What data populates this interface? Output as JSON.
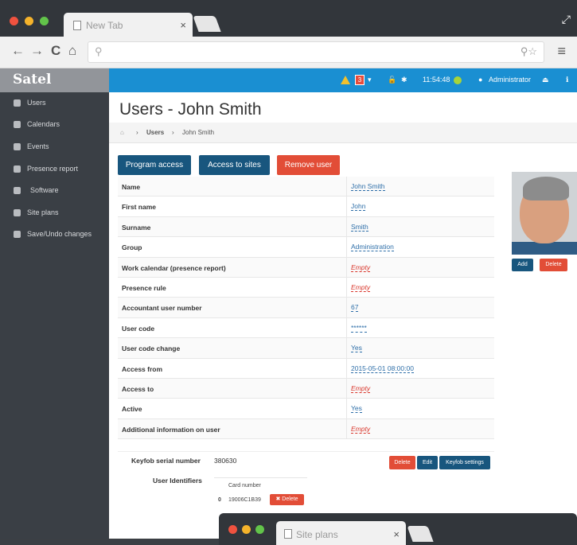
{
  "browser": {
    "tab_title": "New Tab",
    "tab_close": "×",
    "expand_icon": "⤢",
    "back_icon": "←",
    "forward_icon": "→",
    "reload_icon": "C",
    "home_icon": "⌂",
    "search_icon": "⚲",
    "url_right_icons": "⚲☆",
    "menu_icon": "≡"
  },
  "app": {
    "logo": "Satel",
    "sidebar": [
      {
        "label": "Users",
        "icon": "user-icon"
      },
      {
        "label": "Calendars",
        "icon": "calendar-icon"
      },
      {
        "label": "Events",
        "icon": "events-icon"
      },
      {
        "label": "Presence report",
        "icon": "report-icon"
      },
      {
        "label": "Software",
        "icon": "software-icon"
      },
      {
        "label": "Site plans",
        "icon": "image-icon"
      },
      {
        "label": "Save/Undo changes",
        "icon": "save-icon"
      }
    ],
    "topbar": {
      "alert_count": "3",
      "alert_caret": "▾",
      "time": "11:54:48",
      "user_label": "Administrator",
      "logout_icon": "⏏",
      "info_icon": "ℹ",
      "lock_icon": "🔓",
      "gear_icon": "✱"
    },
    "page_title": "Users - John Smith",
    "breadcrumb": {
      "home": "⌂",
      "sep1": "›",
      "users": "Users",
      "sep2": "›",
      "current": "John Smith"
    },
    "actions": {
      "program_access": "Program access",
      "access_to_sites": "Access to sites",
      "remove_user": "Remove user"
    },
    "fields": [
      {
        "key": "Name",
        "value": "John Smith",
        "empty": false
      },
      {
        "key": "First name",
        "value": "John",
        "empty": false
      },
      {
        "key": "Surname",
        "value": "Smith",
        "empty": false
      },
      {
        "key": "Group",
        "value": "Administration",
        "empty": false
      },
      {
        "key": "Work calendar (presence report)",
        "value": "Empty",
        "empty": true
      },
      {
        "key": "Presence rule",
        "value": "Empty",
        "empty": true
      },
      {
        "key": "Accountant user number",
        "value": "67",
        "empty": false
      },
      {
        "key": "User code",
        "value": "******",
        "empty": false
      },
      {
        "key": "User code change",
        "value": "Yes",
        "empty": false
      },
      {
        "key": "Access from",
        "value": "2015-05-01 08:00:00",
        "empty": false
      },
      {
        "key": "Access to",
        "value": "Empty",
        "empty": true
      },
      {
        "key": "Active",
        "value": "Yes",
        "empty": false
      },
      {
        "key": "Additional information on user",
        "value": "Empty",
        "empty": true
      }
    ],
    "photo": {
      "add": "Add",
      "delete": "Delete"
    },
    "keyfob": {
      "serial_label": "Keyfob serial number",
      "serial_value": "380630",
      "delete": "Delete",
      "edit": "Edit",
      "settings": "Keyfob settings",
      "identifiers_label": "User Identifiers",
      "card_header": "Card number",
      "card_index": "0",
      "card_number": "19006C1B39",
      "card_delete": "✖ Delete"
    }
  },
  "second_window": {
    "tab_title": "Site plans",
    "tab_close": "×"
  },
  "colors": {
    "topbar": "#1a8fd2",
    "sidebar": "#3a3f45",
    "dark_button": "#18567e",
    "red_button": "#e24d37"
  }
}
